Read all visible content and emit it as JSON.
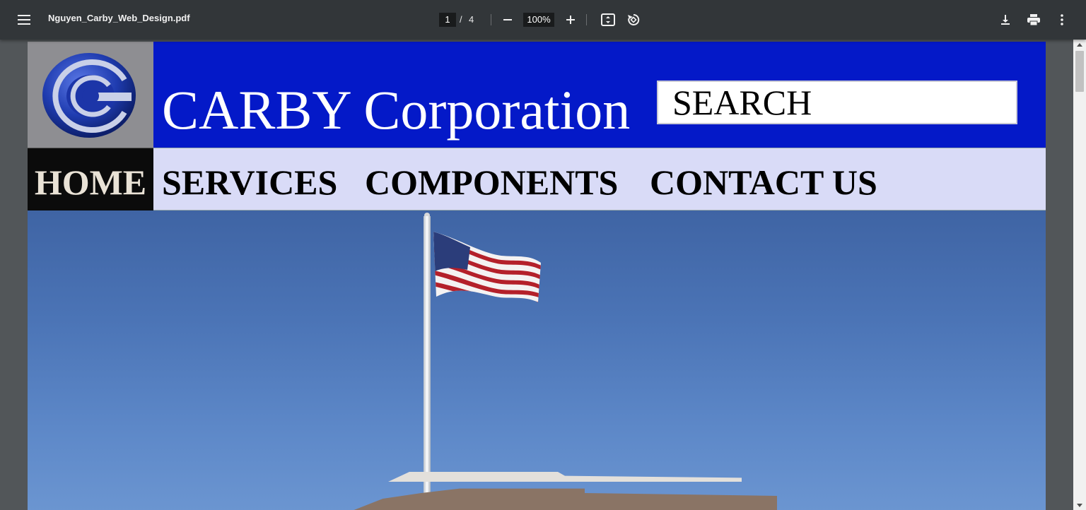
{
  "toolbar": {
    "menu_icon": "hamburger-menu-icon",
    "filename": "Nguyen_Carby_Web_Design.pdf",
    "current_page": "1",
    "page_separator": "/",
    "total_pages": "4",
    "zoom": "100%",
    "icons": {
      "zoom_out": "minus-icon",
      "zoom_in": "plus-icon",
      "fit": "fit-to-page-icon",
      "rotate": "rotate-icon",
      "download": "download-icon",
      "print": "print-icon",
      "more": "more-vertical-icon"
    }
  },
  "document": {
    "company_name": "CARBY Corporation",
    "search_label": "SEARCH",
    "nav": {
      "home": "HOME",
      "services": "SERVICES",
      "components": "COMPONENTS",
      "contact": "CONTACT US"
    },
    "colors": {
      "banner": "#0419c8",
      "nav_bar": "#d9dbf7",
      "home_tab": "#0b0b0b",
      "logo_bg": "#8e8e92",
      "sky": "#4b74b6"
    }
  },
  "scrollbar": {
    "position_fraction": 0
  }
}
